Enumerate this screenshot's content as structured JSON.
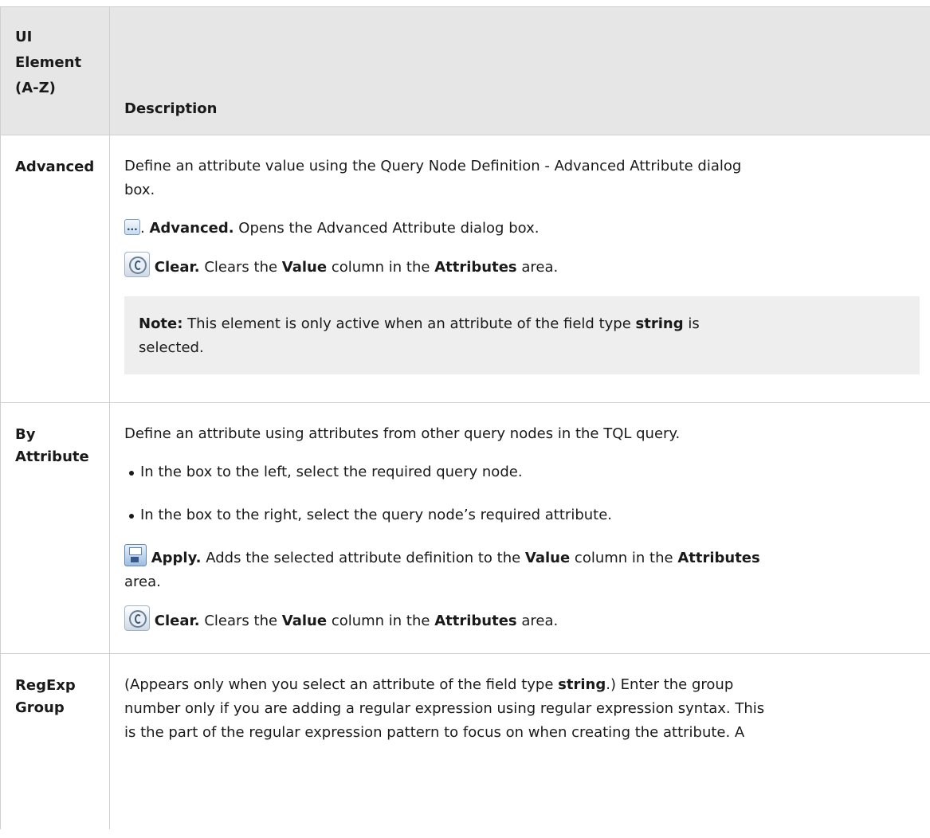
{
  "header": {
    "col1_line1": "UI",
    "col1_line2": "Element",
    "col1_line3": "(A-Z)",
    "col2": "Description"
  },
  "rows": {
    "advanced": {
      "name": "Advanced",
      "desc_line1": "Define an attribute value using the Query Node Definition - Advanced Attribute dialog",
      "desc_line2": "box.",
      "adv_icon_suffix": ". ",
      "adv_bold": "Advanced.",
      "adv_text": " Opens the Advanced Attribute dialog box.",
      "clear_bold": "Clear.",
      "clear_text1": " Clears the ",
      "clear_value": "Value",
      "clear_text2": " column in the ",
      "clear_attributes": "Attributes",
      "clear_text3": " area.",
      "note_label": "Note:",
      "note_text1": " This element is only active when an attribute of the field type ",
      "note_string": "string",
      "note_text2": " is",
      "note_line2": "selected."
    },
    "by_attribute": {
      "name_line1": "By",
      "name_line2": "Attribute",
      "desc": "Define an attribute using attributes from other query nodes in the TQL query.",
      "bullets": [
        "In the box to the left, select the required query node.",
        "In the box to the right, select the query node’s required attribute."
      ],
      "apply_bold": "Apply.",
      "apply_text1": " Adds the selected attribute definition to the ",
      "apply_value": "Value",
      "apply_text2": " column in the ",
      "apply_attributes": "Attributes",
      "apply_line2": "area.",
      "clear_bold": "Clear.",
      "clear_text1": " Clears the ",
      "clear_value": "Value",
      "clear_text2": " column in the ",
      "clear_attributes": "Attributes",
      "clear_text3": " area."
    },
    "regexp": {
      "name_line1": "RegExp",
      "name_line2": "Group",
      "line1_a": "(Appears only when you select an attribute of the field type ",
      "line1_bold": "string",
      "line1_b": ".) Enter the group",
      "line2": "number only if you are adding a regular expression using regular expression syntax. This",
      "line3": "is the part of the regular expression pattern to focus on when creating the attribute. A"
    }
  }
}
